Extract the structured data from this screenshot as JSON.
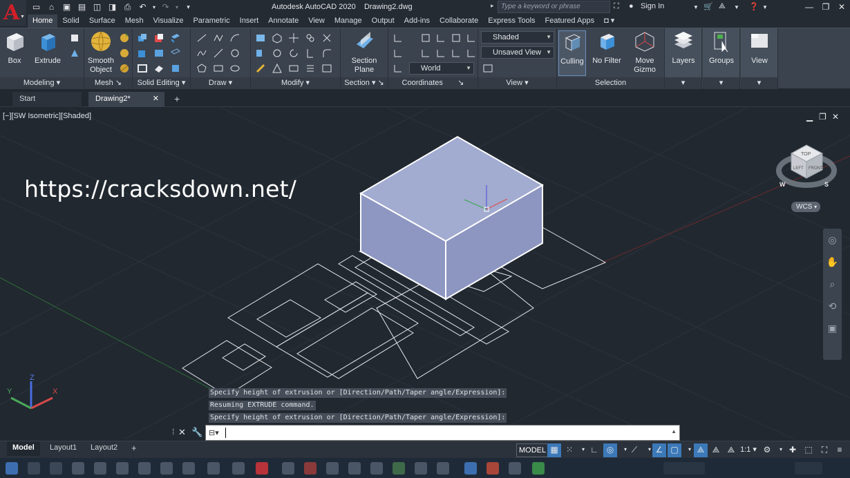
{
  "window": {
    "app_title": "Autodesk AutoCAD 2020",
    "file_name": "Drawing2.dwg",
    "search_placeholder": "Type a keyword or phrase",
    "sign_in": "Sign In"
  },
  "ribbon_tabs": [
    "Home",
    "Solid",
    "Surface",
    "Mesh",
    "Visualize",
    "Parametric",
    "Insert",
    "Annotate",
    "View",
    "Manage",
    "Output",
    "Add-ins",
    "Collaborate",
    "Express Tools",
    "Featured Apps"
  ],
  "ribbon": {
    "box": "Box",
    "extrude": "Extrude",
    "smooth_object": "Smooth Object",
    "section_plane": "Section Plane",
    "culling": "Culling",
    "no_filter": "No Filter",
    "move_gizmo": "Move Gizmo",
    "layers": "Layers",
    "groups": "Groups",
    "view": "View",
    "visual_style": "Shaded",
    "named_view": "Unsaved View",
    "ucs": "World",
    "panels": {
      "modeling": "Modeling",
      "mesh": "Mesh",
      "solid_editing": "Solid Editing",
      "draw": "Draw",
      "modify": "Modify",
      "section": "Section",
      "coordinates": "Coordinates",
      "view": "View",
      "selection": "Selection"
    }
  },
  "doc_tabs": {
    "start": "Start",
    "current": "Drawing2*"
  },
  "viewport": {
    "label": "[−][SW Isometric][Shaded]",
    "wcs": "WCS",
    "watermark": "https://cracksdown.net/",
    "viewcube_top": "TOP",
    "viewcube_left": "LEFT",
    "viewcube_front": "FRONT",
    "compass_w": "W",
    "compass_s": "S",
    "ucs_x": "X",
    "ucs_y": "Y",
    "ucs_z": "Z"
  },
  "command_history": [
    "Specify height of extrusion or [Direction/Path/Taper angle/Expression]:",
    "Resuming EXTRUDE command.",
    "Specify height of extrusion or [Direction/Path/Taper angle/Expression]:"
  ],
  "layout_tabs": {
    "model": "Model",
    "layout1": "Layout1",
    "layout2": "Layout2"
  },
  "status": {
    "model": "MODEL",
    "scale": "1:1"
  },
  "colors": {
    "accent": "#3c79b9",
    "solid_face": "#9aa4c8",
    "logo": "#d21f28"
  }
}
